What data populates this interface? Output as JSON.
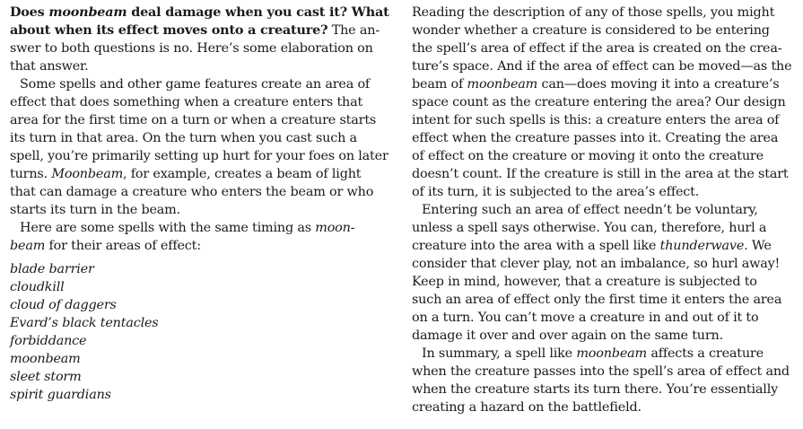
{
  "question": {
    "part1": "Does ",
    "spell": "moonbeam",
    "part2": " deal damage when you cast it? What",
    "line2": "about when its effect moves onto a creature?",
    "answer_tail": " The an-",
    "answer_line2": "swer to both questions is no. Here’s some elaboration on",
    "answer_line3": "that answer."
  },
  "left_paragraphs": {
    "p1": [
      "Some spells and other game features create an area of",
      "effect that does something when a creature enters that",
      "area for the first time on a turn or when a creature starts",
      "its turn in that area. On the turn when you cast such a",
      "spell, you’re primarily setting up hurt for your foes on later",
      "turns."
    ],
    "p1_line6_italic": "Moonbeam",
    "p1_line6_rest": ", for example, creates a beam of light",
    "p1_line7": "that can damage a creature who enters the beam or who",
    "p1_line8": "starts its turn in the beam.",
    "p2_line1_a": "Here are some spells with the same timing as ",
    "p2_line1_italic": "moon-",
    "p2_line2_italic": "beam",
    "p2_line2_rest": " for their areas of effect:"
  },
  "spell_list": [
    "blade barrier",
    "cloudkill",
    "cloud of daggers",
    "Evard’s black tentacles",
    "forbiddance",
    "moonbeam",
    "sleet storm",
    "spirit guardians"
  ],
  "right_paragraphs": {
    "p1_l1": "Reading the description of any of those spells, you might",
    "p1_l2": "wonder whether a creature is considered to be entering",
    "p1_l3": "the spell’s area of effect if the area is created on the crea-",
    "p1_l4": "ture’s space. And if the area of effect can be moved—as the",
    "p1_l5_a": "beam of ",
    "p1_l5_italic": "moonbeam",
    "p1_l5_b": " can—does moving it into a creature’s",
    "p1_l6": "space count as the creature entering the area? Our design",
    "p1_l7": "intent for such spells is this: a creature enters the area of",
    "p1_l8": "effect when the creature passes into it. Creating the area",
    "p1_l9": "of effect on the creature or moving it onto the creature",
    "p1_l10": "doesn’t count. If the creature is still in the area at the start",
    "p1_l11": "of its turn, it is subjected to the area’s effect.",
    "p2_l1": "Entering such an area of effect needn’t be voluntary,",
    "p2_l2": "unless a spell says otherwise. You can, therefore, hurl a",
    "p2_l3_a": "creature into the area with a spell like ",
    "p2_l3_italic": "thunderwave",
    "p2_l3_b": ". We",
    "p2_l4": "consider that clever play, not an imbalance, so hurl away!",
    "p2_l5": "Keep in mind, however, that a creature is subjected to",
    "p2_l6": "such an area of effect only the first time it enters the area",
    "p2_l7": "on a turn. You can’t move a creature in and out of it to",
    "p2_l8": "damage it over and over again on the same turn.",
    "p3_l1_a": "In summary, a spell like ",
    "p3_l1_italic": "moonbeam",
    "p3_l1_b": " affects a creature",
    "p3_l2": "when the creature passes into the spell’s area of effect and",
    "p3_l3": "when the creature starts its turn there. You’re essentially",
    "p3_l4": "creating a hazard on the battlefield."
  }
}
